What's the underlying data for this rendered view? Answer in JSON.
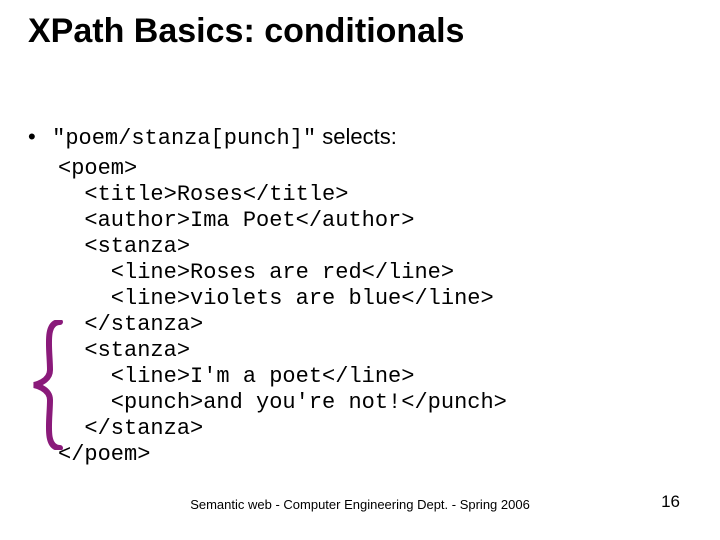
{
  "title": "XPath Basics: conditionals",
  "bullet": {
    "xpath": "\"poem/stanza[punch]\"",
    "selects": " selects:"
  },
  "code": {
    "l1": "<poem>",
    "l2": "  <title>Roses</title>",
    "l3": "  <author>Ima Poet</author>",
    "l4": "  <stanza>",
    "l5": "    <line>Roses are red</line>",
    "l6": "    <line>violets are blue</line>",
    "l7": "  </stanza>",
    "l8": "  <stanza>",
    "l9": "    <line>I'm a poet</line>",
    "l10": "    <punch>and you're not!</punch>",
    "l11": "  </stanza>",
    "l12": "</poem>"
  },
  "footer": "Semantic web - Computer Engineering Dept. - Spring 2006",
  "page": "16"
}
